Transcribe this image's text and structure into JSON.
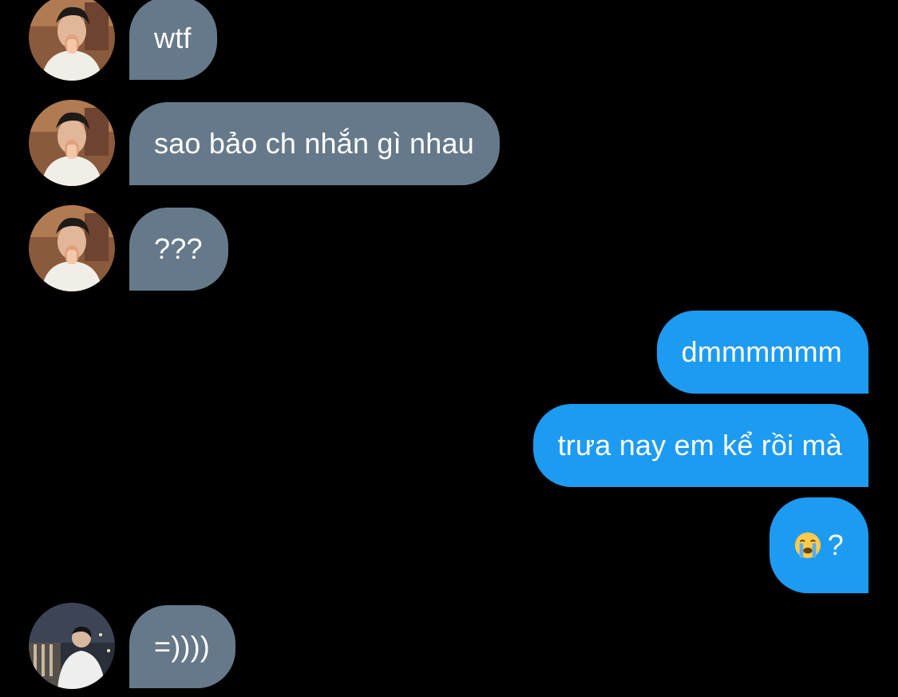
{
  "conversation": {
    "messages": [
      {
        "sender": "other",
        "text": "wtf",
        "avatar": "portrait-cafe"
      },
      {
        "sender": "other",
        "text": "sao bảo ch nhắn gì nhau",
        "avatar": "portrait-cafe"
      },
      {
        "sender": "other",
        "text": "???",
        "avatar": "portrait-cafe"
      },
      {
        "sender": "me",
        "text": "dmmmmmm"
      },
      {
        "sender": "me",
        "text": "trưa nay em kể rồi mà"
      },
      {
        "sender": "me",
        "text": "?",
        "emoji": "loudly-crying-face-emoji"
      },
      {
        "sender": "other",
        "text": "=))))",
        "avatar": "portrait-night"
      }
    ]
  },
  "colors": {
    "background": "#000000",
    "incoming_bubble": "#66798a",
    "outgoing_bubble": "#1d9bf0",
    "text": "#ffffff"
  }
}
